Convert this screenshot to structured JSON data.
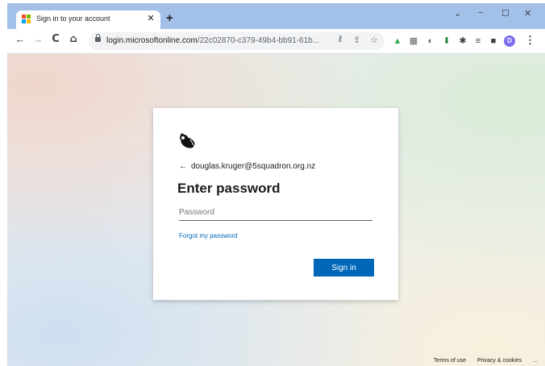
{
  "browser": {
    "tab": {
      "title": "Sign in to your account",
      "close_glyph": "✕",
      "favicon": "microsoft-logo",
      "favicon_colors": [
        "#f25022",
        "#7fba00",
        "#00a4ef",
        "#ffb900"
      ]
    },
    "new_tab_glyph": "+",
    "window_controls": {
      "dropdown": "⌄",
      "minimize": "−",
      "maximize": "☐",
      "close": "✕"
    },
    "nav": {
      "back": "←",
      "forward": "→",
      "reload": "C",
      "home": "⌂"
    },
    "address": {
      "domain": "login.microsoftonline.com",
      "path": "/22c02870-c379-49b4-bb91-61b..."
    },
    "avatar_initial": "D",
    "menu": "⋮",
    "colors": {
      "titlebar": "#a3c0e8",
      "avatar": "#7b6cf0"
    }
  },
  "login": {
    "back_arrow": "←",
    "email": "douglas.kruger@5squadron.org.nz",
    "heading": "Enter password",
    "password_placeholder": "Password",
    "password_value": "",
    "forgot_link": "Forgot my password",
    "signin_label": "Sign in",
    "accent_color": "#0067b8"
  },
  "footer": {
    "terms": "Terms of use",
    "privacy": "Privacy & cookies",
    "more": "..."
  }
}
